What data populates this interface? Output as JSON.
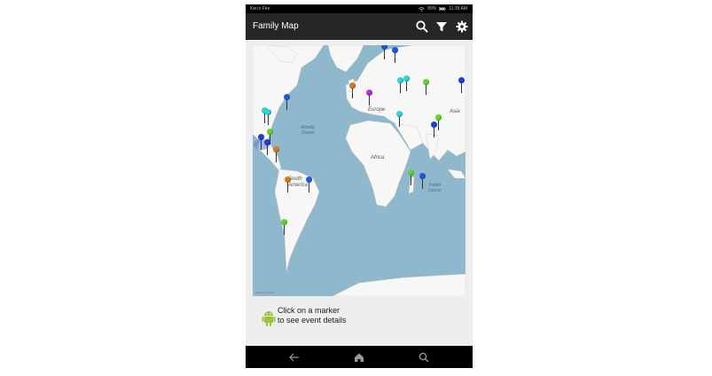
{
  "status_bar": {
    "carrier": "Ken's Fire",
    "battery": "89%",
    "time": "11:39 AM",
    "icons": [
      "wifi-icon",
      "battery-icon"
    ]
  },
  "app_bar": {
    "title": "Family Map",
    "actions": [
      {
        "name": "search",
        "icon": "search-icon"
      },
      {
        "name": "filter",
        "icon": "filter-icon"
      },
      {
        "name": "settings",
        "icon": "gear-icon"
      }
    ]
  },
  "map": {
    "labels": {
      "atlantic": "Atlantic\nOcean",
      "indian": "Indian\nOcean",
      "europe": "Europe",
      "asia": "Asia",
      "africa": "Africa",
      "south_america": "South\nAmerica"
    },
    "attribution": "Map data ©2016",
    "markers": [
      {
        "color": "#1e5bd6",
        "region": "arctic"
      },
      {
        "color": "#1e5bd6",
        "region": "scandinavia"
      },
      {
        "color": "#2ad6d6",
        "region": "russia-west"
      },
      {
        "color": "#2ad6d6",
        "region": "russia-west"
      },
      {
        "color": "#5fd62a",
        "region": "russia"
      },
      {
        "color": "#1e3fd6",
        "region": "east-russia"
      },
      {
        "color": "#d67a1e",
        "region": "uk"
      },
      {
        "color": "#c12ad6",
        "region": "central-europe"
      },
      {
        "color": "#2ad6d6",
        "region": "middle-east"
      },
      {
        "color": "#5fd62a",
        "region": "central-asia"
      },
      {
        "color": "#1e3fd6",
        "region": "india"
      },
      {
        "color": "#1e5bd6",
        "region": "east-canada"
      },
      {
        "color": "#2ad6d6",
        "region": "usa-east"
      },
      {
        "color": "#2ad6d6",
        "region": "usa"
      },
      {
        "color": "#5fd62a",
        "region": "gulf"
      },
      {
        "color": "#1e3fd6",
        "region": "mexico"
      },
      {
        "color": "#1e3fd6",
        "region": "central-america"
      },
      {
        "color": "#d67a1e",
        "region": "caribbean"
      },
      {
        "color": "#d67a1e",
        "region": "peru"
      },
      {
        "color": "#1e5bd6",
        "region": "brazil"
      },
      {
        "color": "#5fd62a",
        "region": "madagascar"
      },
      {
        "color": "#1e5bd6",
        "region": "madagascar-east"
      },
      {
        "color": "#5fd62a",
        "region": "argentina"
      }
    ]
  },
  "info": {
    "line1": "Click on a marker",
    "line2": "to see event details",
    "icon": "android-icon",
    "icon_color": "#9bc33c"
  },
  "nav_bar": {
    "buttons": [
      {
        "name": "back",
        "icon": "back-arrow-icon"
      },
      {
        "name": "home",
        "icon": "home-icon"
      },
      {
        "name": "search",
        "icon": "search-icon"
      }
    ]
  }
}
